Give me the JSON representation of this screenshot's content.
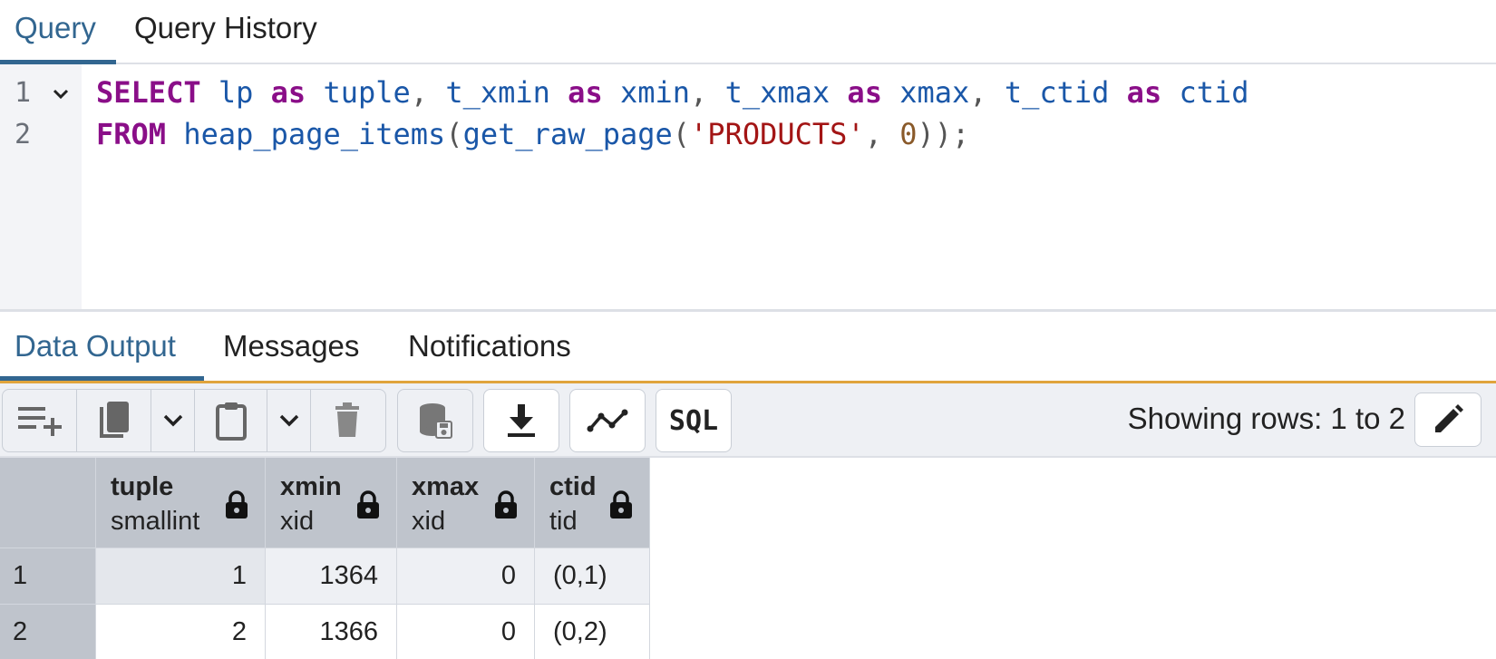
{
  "tabs": {
    "query": "Query",
    "query_history": "Query History"
  },
  "editor": {
    "line_numbers": [
      "1",
      "2"
    ],
    "line1": {
      "kw_select": "SELECT",
      "id_lp": "lp",
      "kw_as1": "as",
      "id_tuple": "tuple",
      "id_t_xmin": "t_xmin",
      "kw_as2": "as",
      "id_xmin": "xmin",
      "id_t_xmax": "t_xmax",
      "kw_as3": "as",
      "id_xmax": "xmax",
      "id_t_ctid": "t_ctid",
      "kw_as4": "as",
      "id_ctid": "ctid"
    },
    "line2": {
      "kw_from": "FROM",
      "fn_heap": "heap_page_items",
      "fn_raw": "get_raw_page",
      "str_table": "'PRODUCTS'",
      "num_page": "0"
    }
  },
  "output_tabs": {
    "data_output": "Data Output",
    "messages": "Messages",
    "notifications": "Notifications"
  },
  "toolbar": {
    "sql_label": "SQL",
    "rows_status": "Showing rows: 1 to 2"
  },
  "grid": {
    "columns": [
      {
        "name": "tuple",
        "type": "smallint"
      },
      {
        "name": "xmin",
        "type": "xid"
      },
      {
        "name": "xmax",
        "type": "xid"
      },
      {
        "name": "ctid",
        "type": "tid"
      }
    ],
    "rows": [
      {
        "num": "1",
        "tuple": "1",
        "xmin": "1364",
        "xmax": "0",
        "ctid": "(0,1)"
      },
      {
        "num": "2",
        "tuple": "2",
        "xmin": "1366",
        "xmax": "0",
        "ctid": "(0,2)"
      }
    ]
  },
  "colors": {
    "accent": "#326690",
    "keyword": "#8a0e88",
    "identifier": "#1a57a8",
    "string": "#a31515",
    "number": "#8a5a2a",
    "tab_underline": "#e0a43c"
  }
}
